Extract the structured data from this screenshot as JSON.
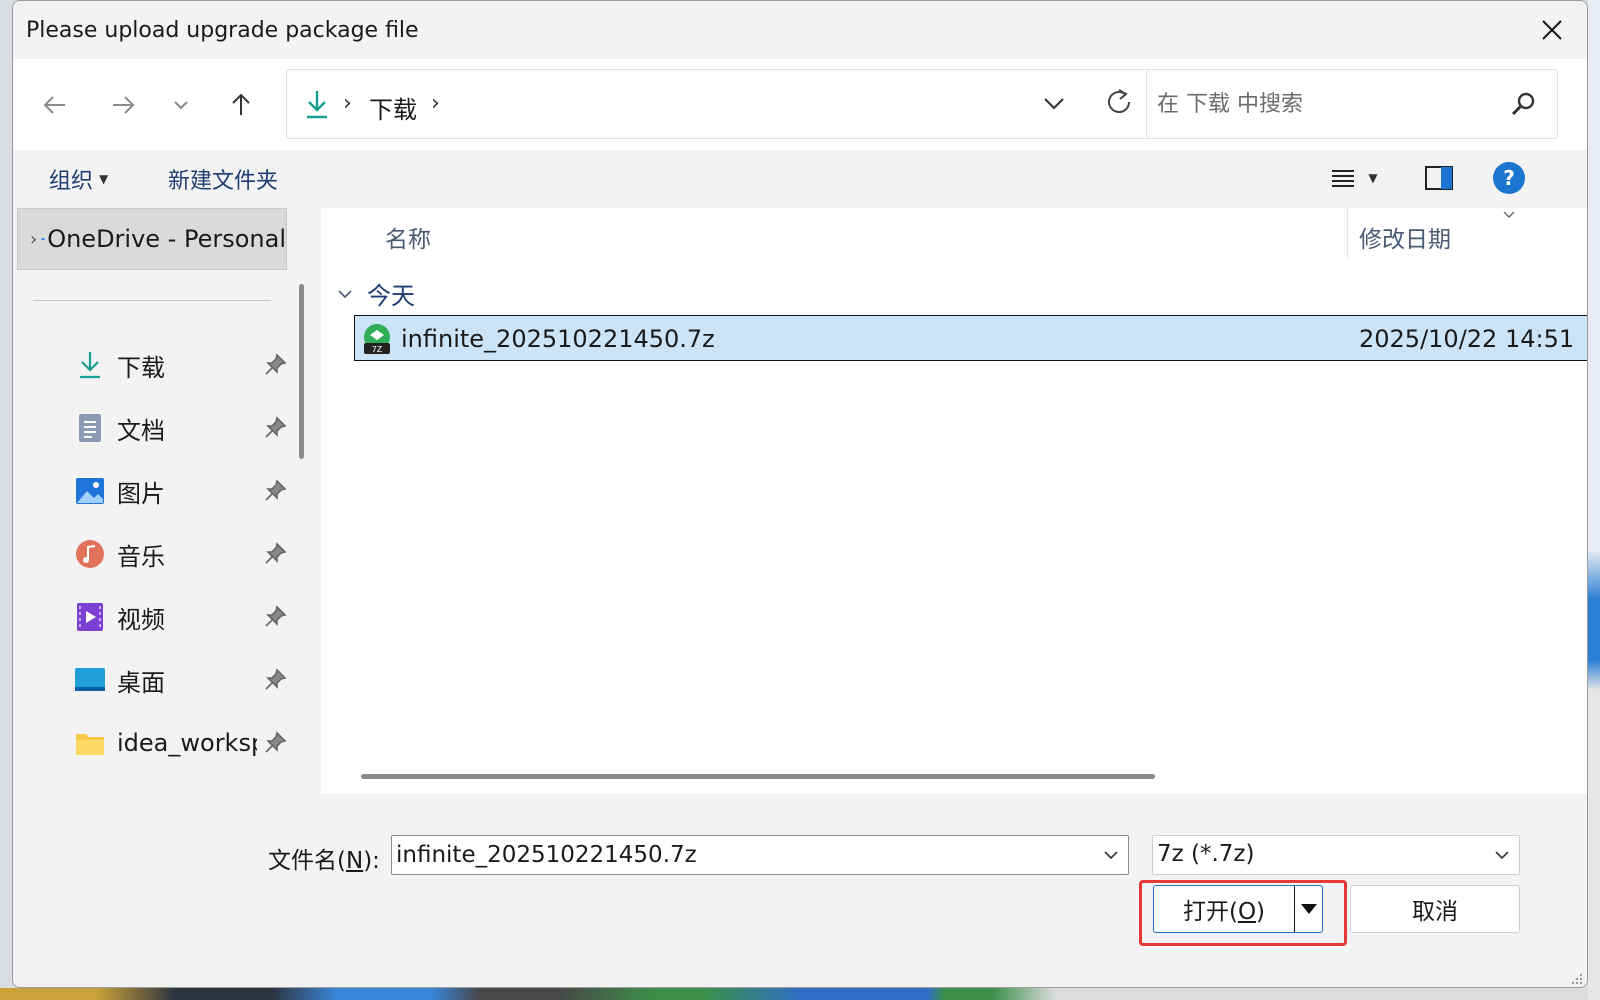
{
  "dialog": {
    "title": "Please upload upgrade package file"
  },
  "nav": {
    "back_icon": "arrow-left-icon",
    "forward_icon": "arrow-right-icon",
    "recent_icon": "chevron-down-icon",
    "up_icon": "arrow-up-icon",
    "address": {
      "location_icon": "download-icon",
      "separator": "›",
      "folder": "下载",
      "trailing_separator": "›"
    },
    "search": {
      "placeholder": "在 下载 中搜索"
    }
  },
  "toolbar": {
    "organize_label": "组织",
    "new_folder_label": "新建文件夹",
    "help_label": "?"
  },
  "sidebar": {
    "onedrive_label": "OneDrive - Personal",
    "items": [
      {
        "label": "下载",
        "icon": "download-icon"
      },
      {
        "label": "文档",
        "icon": "document-icon"
      },
      {
        "label": "图片",
        "icon": "pictures-icon"
      },
      {
        "label": "音乐",
        "icon": "music-icon"
      },
      {
        "label": "视频",
        "icon": "video-icon"
      },
      {
        "label": "桌面",
        "icon": "desktop-icon"
      },
      {
        "label": "idea_workspace",
        "icon": "folder-icon"
      }
    ]
  },
  "content": {
    "columns": {
      "name": "名称",
      "date": "修改日期"
    },
    "group_label": "今天",
    "files": [
      {
        "name": "infinite_202510221450.7z",
        "modified": "2025/10/22 14:51",
        "icon": "7z-archive-icon",
        "selected": true
      }
    ]
  },
  "footer": {
    "filename_label_prefix": "文件名(",
    "filename_label_key": "N",
    "filename_label_suffix": "):",
    "filename_value": "infinite_202510221450.7z",
    "filetype_value": "7z (*.7z)",
    "open_label_prefix": "打开(",
    "open_label_key": "O",
    "open_label_suffix": ")",
    "cancel_label": "取消"
  },
  "colors": {
    "selection": "#cce4f7",
    "accent": "#0067c0",
    "highlight_annotation": "#e53935"
  }
}
